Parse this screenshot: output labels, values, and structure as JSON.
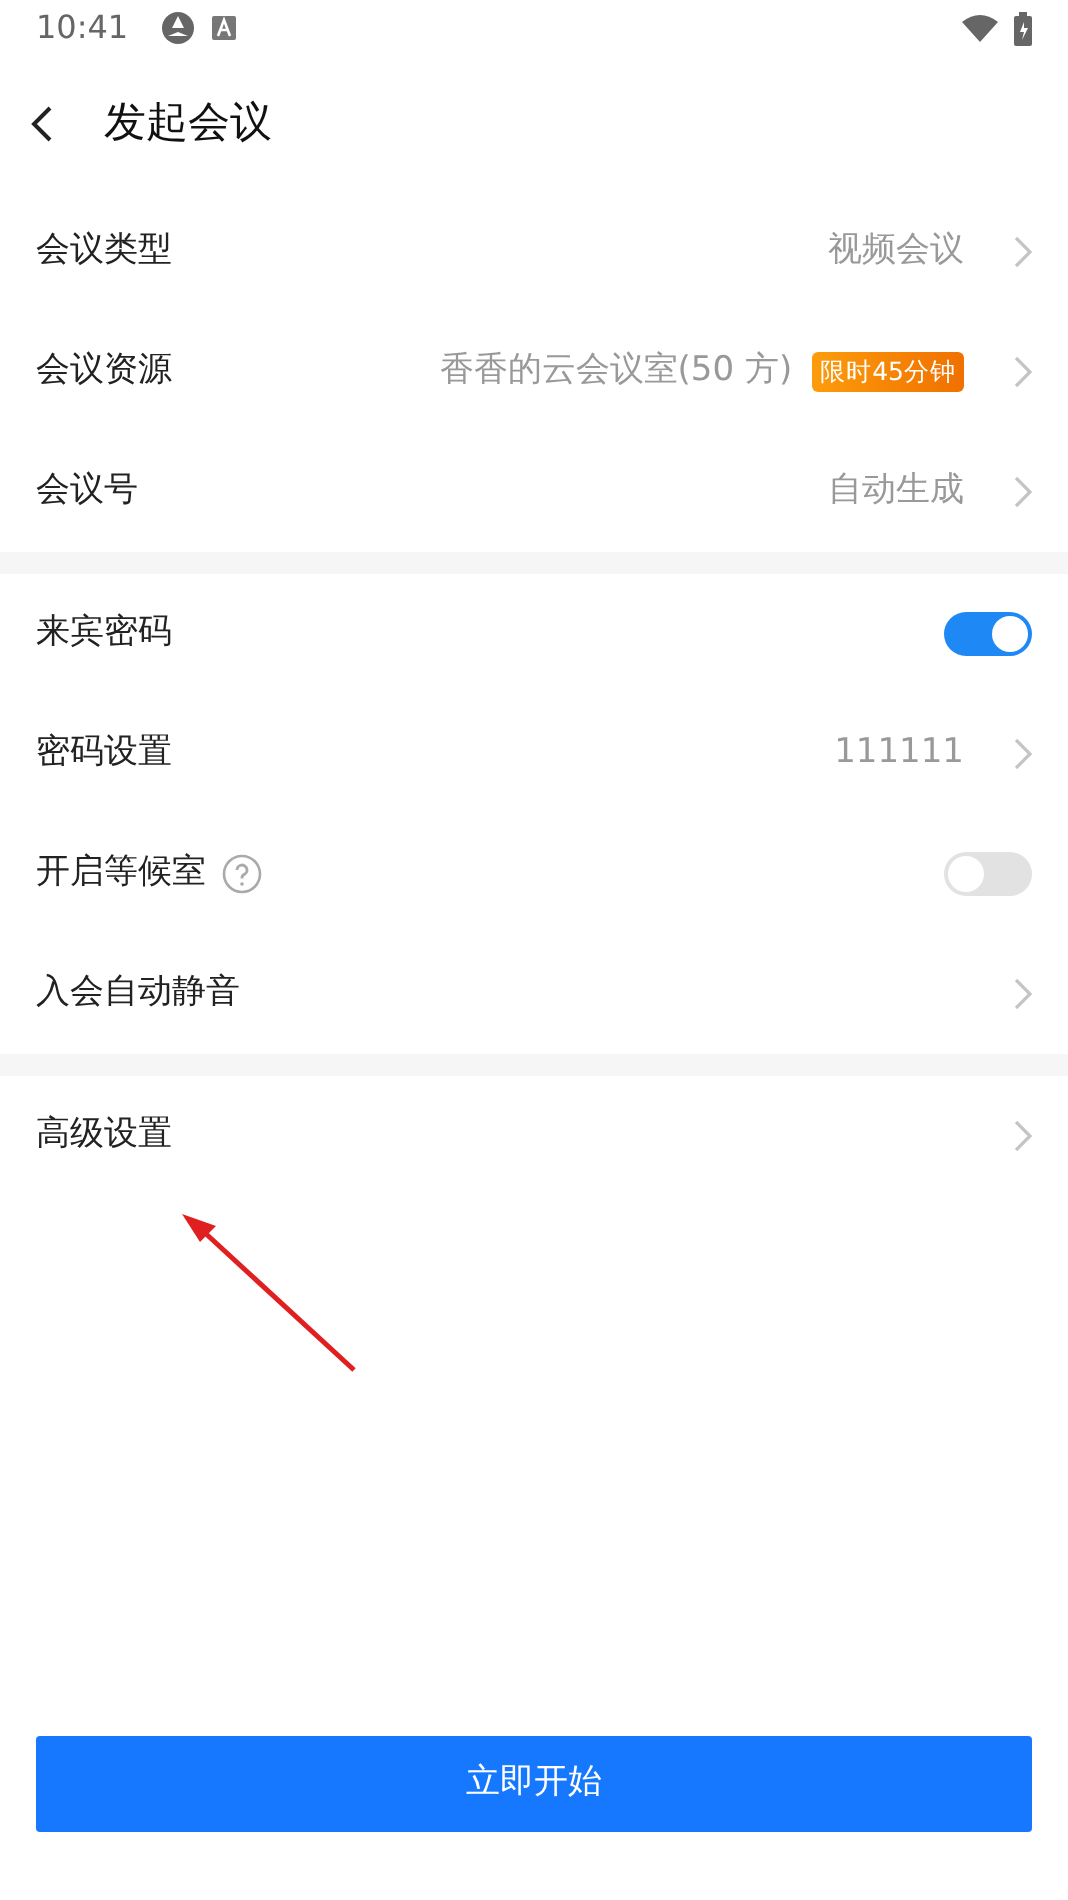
{
  "status_bar": {
    "time": "10:41"
  },
  "header": {
    "title": "发起会议"
  },
  "sections": [
    {
      "rows": [
        {
          "kind": "link",
          "label": "会议类型",
          "value": "视频会议"
        },
        {
          "kind": "link",
          "label": "会议资源",
          "value": "香香的云会议室(50 方)",
          "badge": "限时45分钟"
        },
        {
          "kind": "link",
          "label": "会议号",
          "value": "自动生成"
        }
      ]
    },
    {
      "rows": [
        {
          "kind": "toggle",
          "label": "来宾密码",
          "on": true
        },
        {
          "kind": "link",
          "label": "密码设置",
          "value": "111111"
        },
        {
          "kind": "toggle",
          "label": "开启等候室",
          "help": true,
          "on": false
        },
        {
          "kind": "link",
          "label": "入会自动静音"
        }
      ]
    },
    {
      "rows": [
        {
          "kind": "link",
          "label": "高级设置"
        }
      ]
    }
  ],
  "start_button": "立即开始"
}
